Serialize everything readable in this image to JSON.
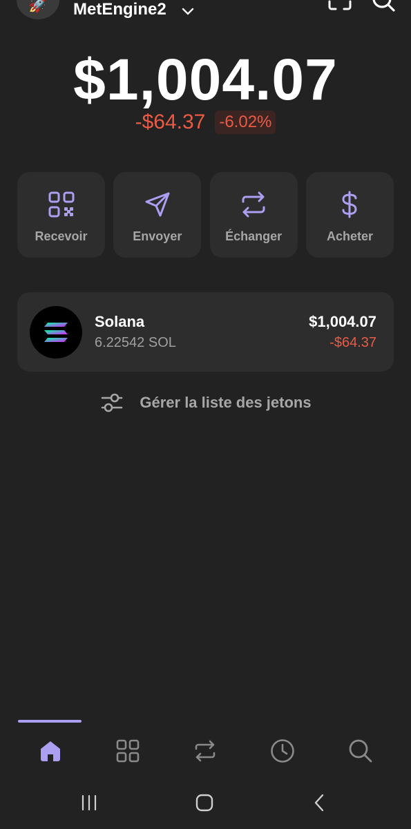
{
  "header": {
    "account_name": "MetEngine2",
    "avatar_emoji": "🚀",
    "icons": [
      "rocket-icon",
      "chevron-down-icon",
      "scan-icon",
      "search-icon"
    ]
  },
  "balance": {
    "total": "$1,004.07",
    "change_abs": "-$64.37",
    "change_pct": "-6.02%"
  },
  "actions": [
    {
      "label": "Recevoir",
      "icon": "qr-code-icon"
    },
    {
      "label": "Envoyer",
      "icon": "send-icon"
    },
    {
      "label": "Échanger",
      "icon": "swap-icon"
    },
    {
      "label": "Acheter",
      "icon": "dollar-icon"
    }
  ],
  "tokens": [
    {
      "name": "Solana",
      "amount": "6.22542 SOL",
      "value": "$1,004.07",
      "change": "-$64.37",
      "icon": "solana-logo-icon"
    }
  ],
  "manage_tokens_label": "Gérer la liste des jetons",
  "tabbar": {
    "items": [
      "home-icon",
      "collectibles-icon",
      "swap-icon",
      "history-icon",
      "search-icon"
    ],
    "active": "home-icon"
  },
  "colors": {
    "background": "#222222",
    "card": "#2d2d2d",
    "accent": "#ab9ff2",
    "negative": "#eb5a45",
    "muted_text": "#a7a7a7"
  }
}
